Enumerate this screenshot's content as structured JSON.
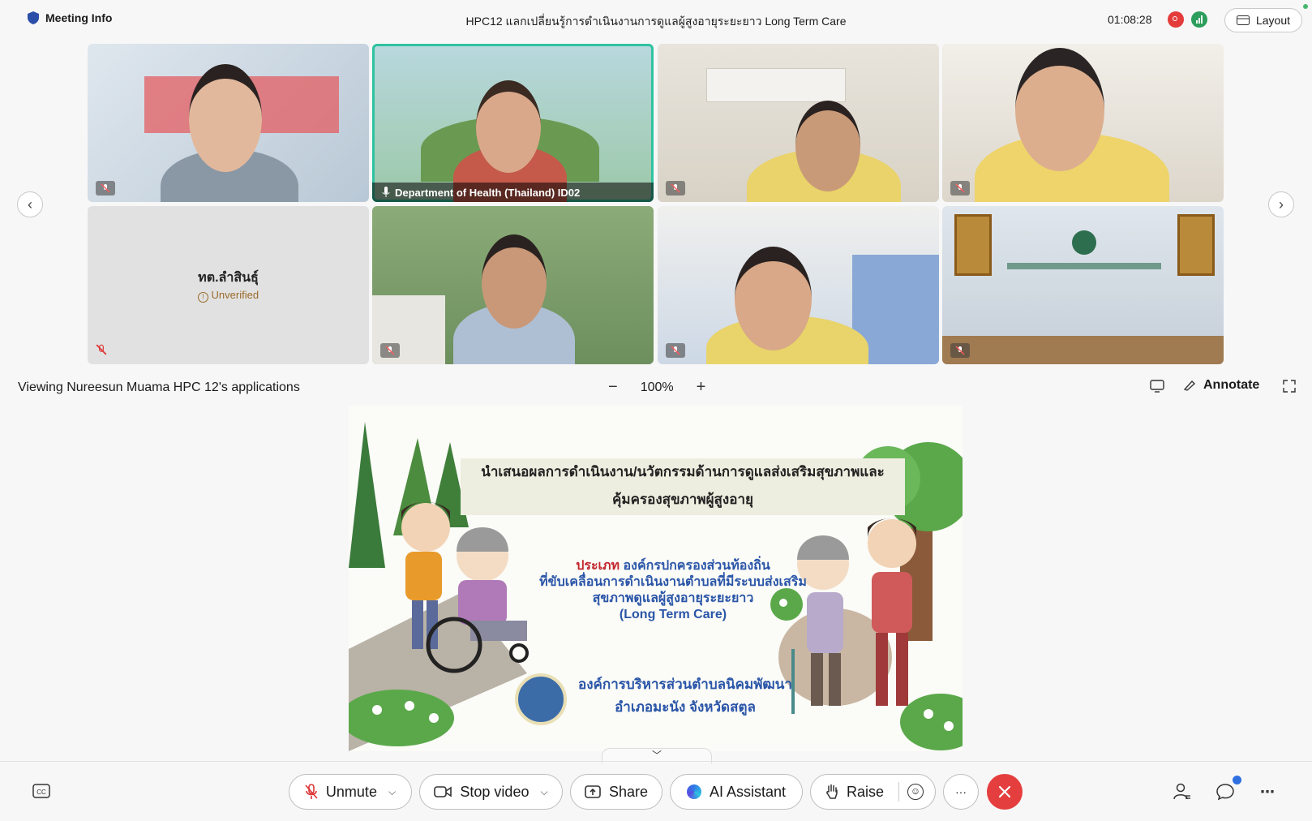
{
  "header": {
    "meeting_info": "Meeting Info",
    "title": "HPC12 แลกเปลี่ยนรู้การดำเนินงานการดูแลผู้สูงอายุระยะยาว Long Term Care",
    "timer": "01:08:28",
    "layout_label": "Layout"
  },
  "participants": {
    "highlighted_name": "Department of Health (Thailand) ID02",
    "placeholder_name": "ทต.ลำสินธุ์",
    "placeholder_status": "Unverified"
  },
  "share": {
    "viewing_label": "Viewing Nureesun Muama HPC 12's applications",
    "zoom_level": "100%",
    "zoom_out": "−",
    "zoom_in": "+",
    "annotate_label": "Annotate"
  },
  "slide": {
    "title_line1": "นำเสนอผลการดำเนินงาน/นวัตกรรมด้านการดูแลส่งเสริมสุขภาพและ",
    "title_line2": "คุ้มครองสุขภาพผู้สูงอายุ",
    "type_prefix": "ประเภท",
    "type_line1": "องค์กรปกครองส่วนท้องถิ่น",
    "type_line2": "ที่ขับเคลื่อนการดำเนินงานตำบลที่มีระบบส่งเสริม",
    "type_line3": "สุขภาพดูแลผู้สูงอายุระยะยาว",
    "type_line4": "(Long Term Care)",
    "org_line1": "องค์การบริหารส่วนตำบลนิคมพัฒนา",
    "org_line2": "อำเภอมะนัง จังหวัดสตูล"
  },
  "controls": {
    "unmute_label": "Unmute",
    "stop_video_label": "Stop video",
    "share_label": "Share",
    "ai_label": "AI Assistant",
    "raise_label": "Raise",
    "more_label": "···"
  },
  "colors": {
    "accent": "#2ec3a0",
    "end_call": "#e53e3e",
    "record": "#e43b3b",
    "slide_blue": "#2a55a8"
  }
}
